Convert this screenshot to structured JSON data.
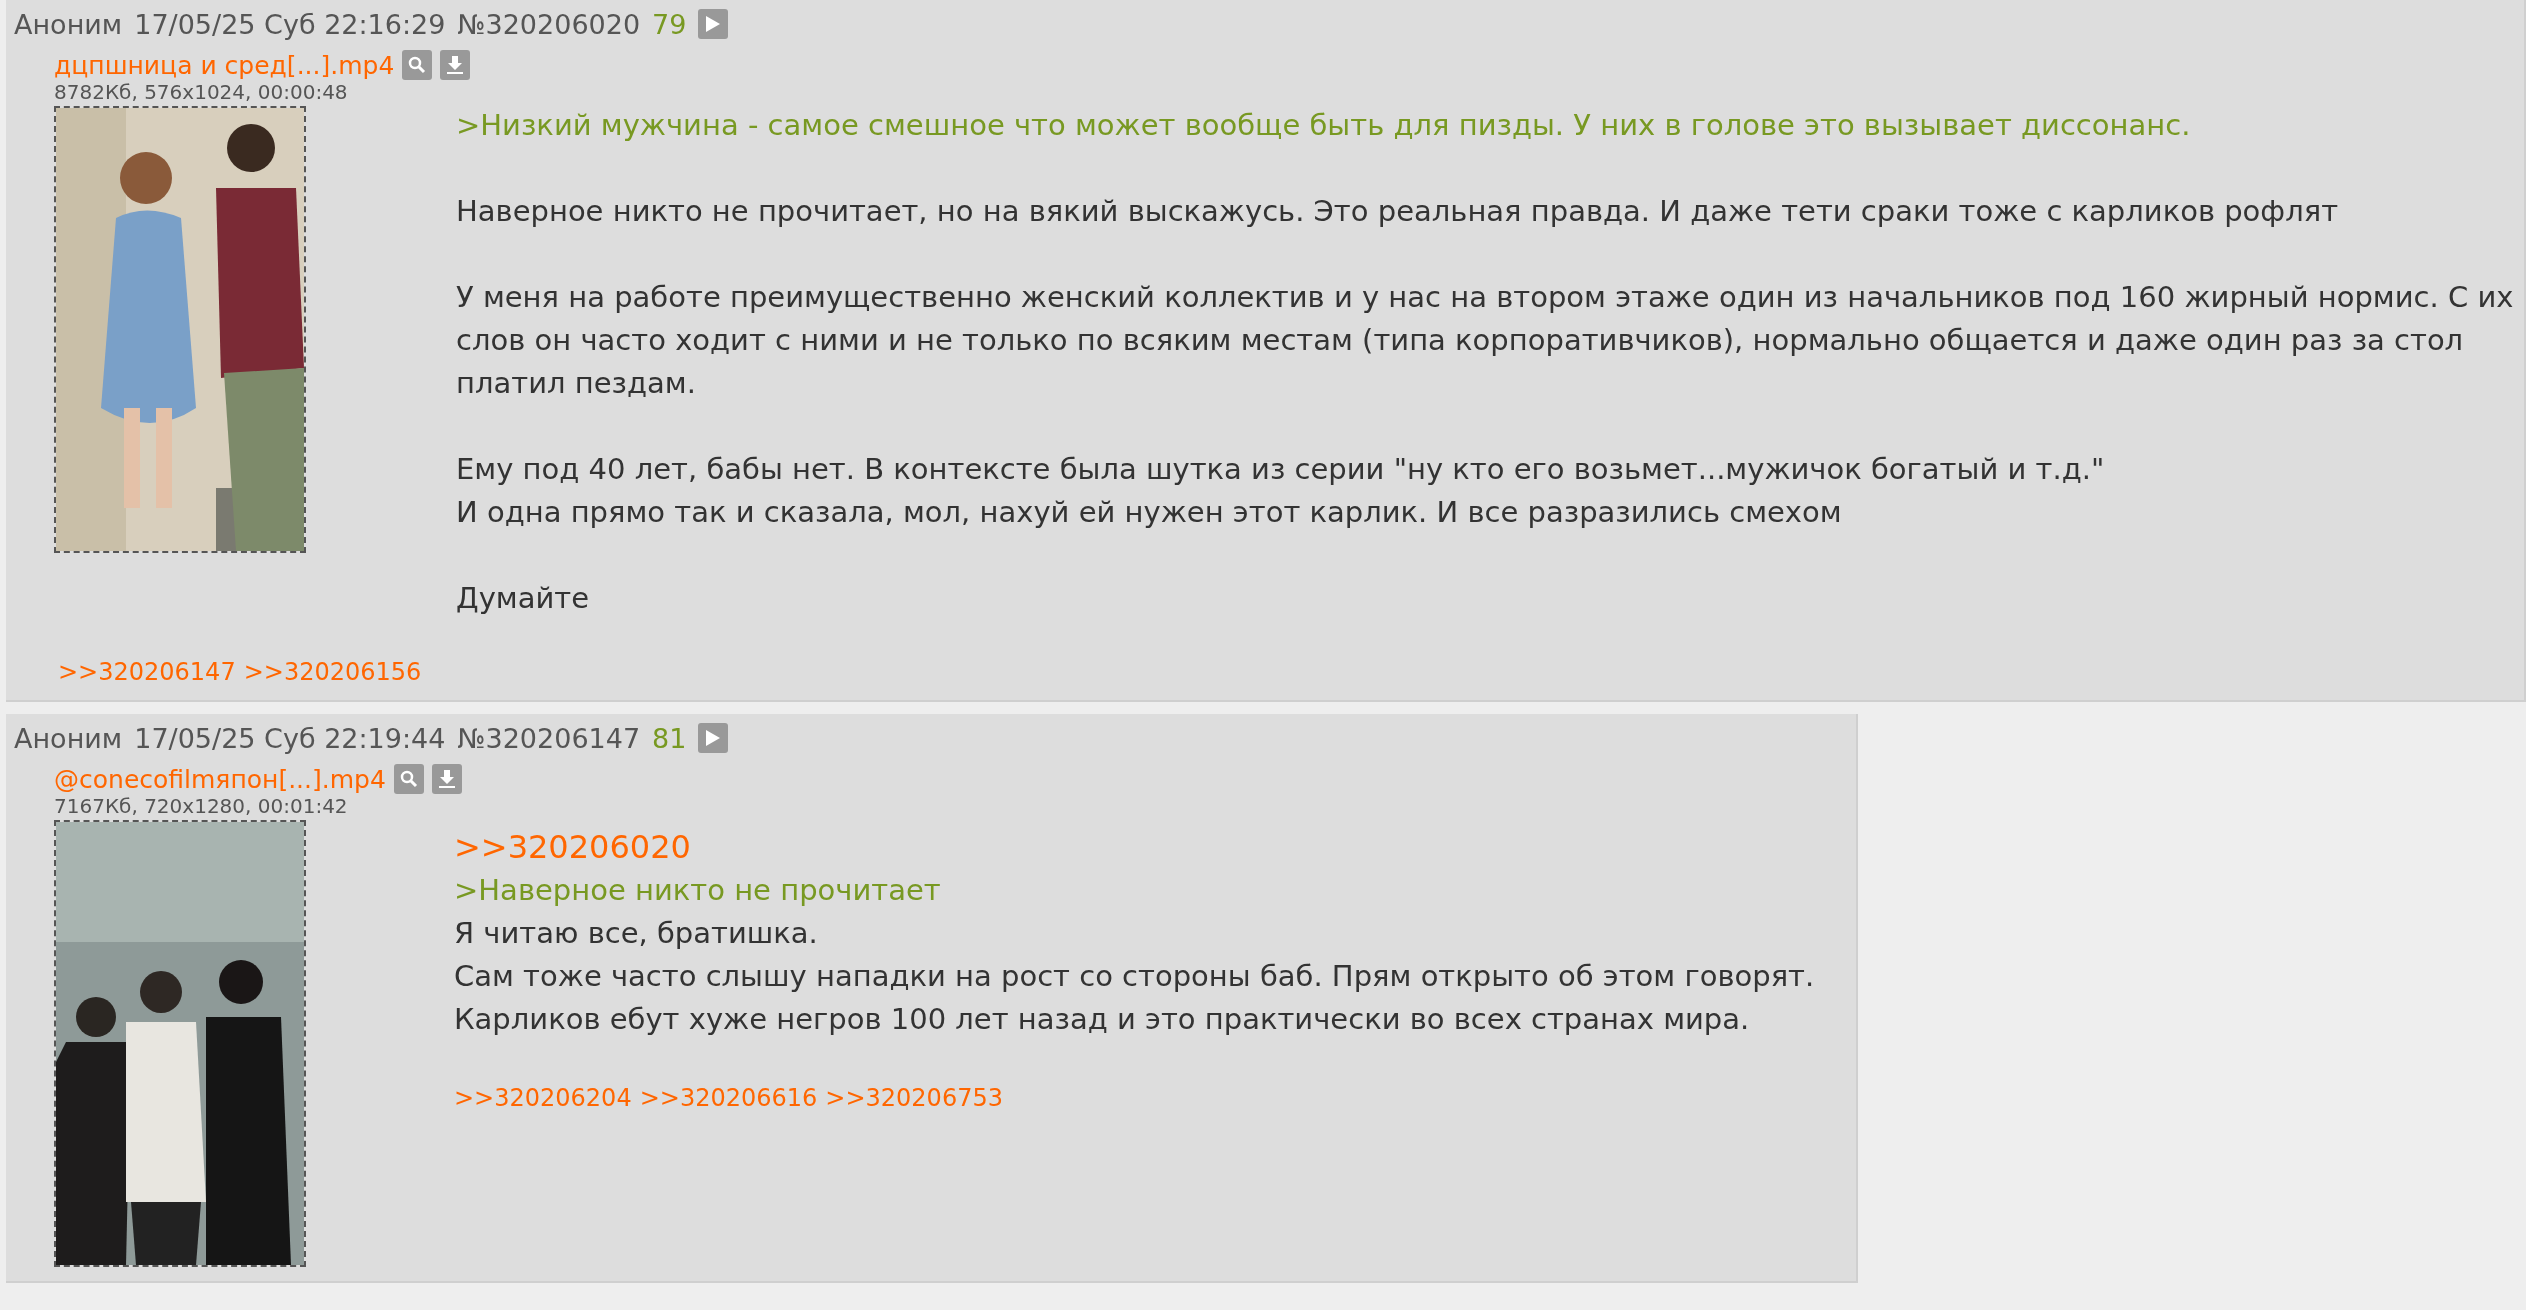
{
  "posts": [
    {
      "name": "Аноним",
      "date": "17/05/25 Суб 22:16:29",
      "number": "№320206020",
      "index": "79",
      "wide": true,
      "file": {
        "name": "дцпшница и сред[...].mp4",
        "info": "8782Кб, 576x1024, 00:00:48",
        "kind": "picture"
      },
      "paragraphs": [
        [
          {
            "kind": "quote",
            "text": ">Низкий мужчина - самое смешное что может вообще быть для пизды. У них в голове это вызывает диссонанс."
          }
        ],
        [
          {
            "kind": "text",
            "text": "Наверное никто не прочитает, но на вякий выскажусь. Это реальная правда. И даже тети сраки тоже с карликов рофлят"
          }
        ],
        [
          {
            "kind": "text",
            "text": "У меня на работе преимущественно женский коллектив и у нас на втором этаже один из начальников под 160 жирный нормис. С их слов он часто ходит с ними и не только по всяким местам (типа корпоративчиков), нормально общается и даже один раз за стол платил пездам."
          }
        ],
        [
          {
            "kind": "text",
            "text": "Ему под 40 лет, бабы нет. В контексте была шутка из серии \"ну кто его возьмет...мужичок богатый и т.д.\""
          },
          {
            "kind": "text",
            "text": "И одна прямо так и сказала, мол, нахуй ей нужен этот карлик. И все разразились смехом"
          }
        ],
        [
          {
            "kind": "text",
            "text": "Думайте"
          }
        ]
      ],
      "replies": [
        ">>320206147",
        ">>320206156"
      ]
    },
    {
      "name": "Аноним",
      "date": "17/05/25 Суб 22:19:44",
      "number": "№320206147",
      "index": "81",
      "wide": false,
      "file": {
        "name": "@conecofilmяпон[...].mp4",
        "info": "7167Кб, 720x1280, 00:01:42",
        "kind": "picture"
      },
      "paragraphs": [
        [
          {
            "kind": "link",
            "text": ">>320206020"
          },
          {
            "kind": "quote",
            "text": ">Наверное никто не прочитает"
          },
          {
            "kind": "text",
            "text": "Я читаю все, братишка."
          },
          {
            "kind": "text",
            "text": "Сам тоже часто слышу нападки на рост со стороны баб. Прям открыто об этом говорят."
          },
          {
            "kind": "text",
            "text": "Карликов ебут хуже негров 100 лет назад и это практически во всех странах мира."
          }
        ]
      ],
      "replies": [
        ">>320206204",
        ">>320206616",
        ">>320206753"
      ]
    }
  ]
}
